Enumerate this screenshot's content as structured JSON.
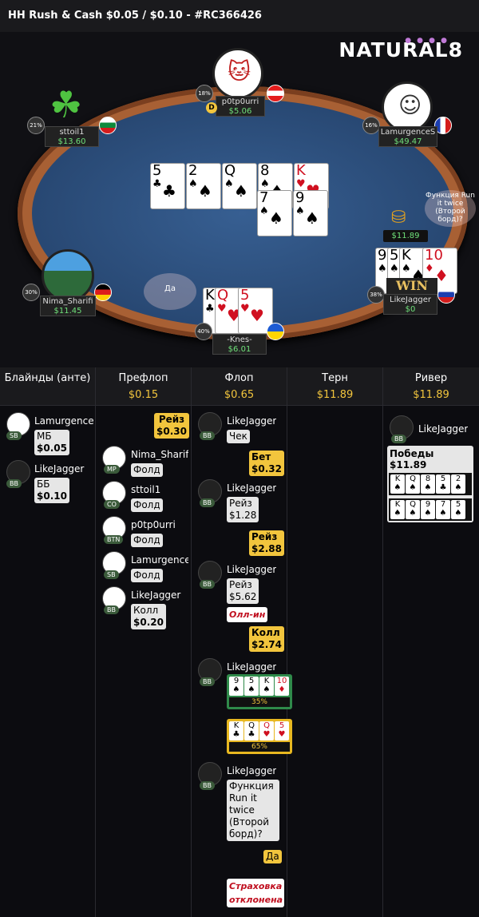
{
  "title": "HH Rush & Cash $0.05 / $0.10 - #RC366426",
  "brand": {
    "logo": "NATURAL8",
    "accent": "#f2c53d"
  },
  "board": {
    "row1": [
      {
        "r": "5",
        "s": "♣",
        "red": false
      },
      {
        "r": "2",
        "s": "♠",
        "red": false
      },
      {
        "r": "Q",
        "s": "♠",
        "red": false
      },
      {
        "r": "8",
        "s": "♠",
        "red": false
      },
      {
        "r": "K",
        "s": "♥",
        "red": true
      }
    ],
    "row2": [
      {
        "r": "7",
        "s": "♠",
        "red": false
      },
      {
        "r": "9",
        "s": "♠",
        "red": false
      }
    ]
  },
  "seats": {
    "top": {
      "name": "p0tp0urri",
      "amount": "$5.06",
      "pct": "18%",
      "dealer": "D"
    },
    "left": {
      "name": "sttoil1",
      "amount": "$13.60",
      "pct": "21%"
    },
    "right": {
      "name": "LamurgenceS",
      "amount": "$49.47",
      "pct": "16%"
    },
    "left_bottom": {
      "name": "Nima_Sharifi",
      "amount": "$11.45",
      "pct": "30%"
    },
    "bottom": {
      "name": "-Knes-",
      "amount": "$6.01",
      "pct": "40%",
      "cards": [
        {
          "r": "K",
          "s": "♣",
          "red": false
        },
        {
          "r": "Q",
          "s": "♥",
          "red": true
        },
        {
          "r": "5",
          "s": "♥",
          "red": true
        }
      ]
    },
    "right_bottom": {
      "name": "LikeJagger",
      "amount": "$0",
      "pct": "38%",
      "win": "WIN",
      "cards": [
        {
          "r": "9",
          "s": "♠",
          "red": false
        },
        {
          "r": "5",
          "s": "♠",
          "red": false
        },
        {
          "r": "K",
          "s": "♠",
          "red": false
        },
        {
          "r": "10",
          "s": "♦",
          "red": true
        }
      ]
    }
  },
  "pot_amount": "$11.89",
  "bubble_yes": "Да",
  "bubble_rit": "Функция Run it twice (Второй борд)?",
  "columns": [
    {
      "title": "Блайнды (анте)",
      "amount": ""
    },
    {
      "title": "Префлоп",
      "amount": "$0.15"
    },
    {
      "title": "Флоп",
      "amount": "$0.65"
    },
    {
      "title": "Терн",
      "amount": "$11.89"
    },
    {
      "title": "Ривер",
      "amount": "$11.89"
    }
  ],
  "blinds": [
    {
      "name": "Lamurgence",
      "pos": "SB",
      "action": "МБ",
      "amount": "$0.05"
    },
    {
      "name": "LikeJagger",
      "pos": "BB",
      "action": "ББ",
      "amount": "$0.10"
    }
  ],
  "preflop": {
    "raise": {
      "action": "Рейз",
      "amount": "$0.30"
    },
    "rows": [
      {
        "name": "Nima_Sharifi",
        "pos": "MP",
        "action": "Фолд"
      },
      {
        "name": "sttoil1",
        "pos": "CO",
        "action": "Фолд"
      },
      {
        "name": "p0tp0urri",
        "pos": "BTN",
        "action": "Фолд"
      },
      {
        "name": "Lamurgence",
        "pos": "SB",
        "action": "Фолд"
      },
      {
        "name": "LikeJagger",
        "pos": "BB",
        "action": "Колл",
        "amount": "$0.20"
      }
    ]
  },
  "flop": {
    "name": "LikeJagger",
    "pos": "BB",
    "check": "Чек",
    "bet": {
      "action": "Бет",
      "amount": "$0.32"
    },
    "raise1": {
      "action": "Рейз",
      "amount": "$1.28"
    },
    "raise2": {
      "action": "Рейз",
      "amount": "$2.88"
    },
    "raise3": {
      "action": "Рейз",
      "amount": "$5.62"
    },
    "allin": "Олл-ин",
    "call": {
      "action": "Колл",
      "amount": "$2.74"
    },
    "equity1": {
      "cards": [
        "9♠",
        "5♠",
        "K♠",
        "10♦"
      ],
      "pct": "35%"
    },
    "equity2": {
      "cards": [
        "K♣",
        "Q♣",
        "Q♥",
        "5♥"
      ],
      "pct": "65%"
    },
    "rit_question": "Функция Run it twice (Второй борд)?",
    "yes": "Да",
    "insurance": "Страховка отклонена"
  },
  "river": {
    "name": "LikeJagger",
    "pos": "BB",
    "wins": "Победы $11.89",
    "hand1": [
      "K♠",
      "Q♠",
      "8♠",
      "5♣",
      "2♠"
    ],
    "hand2": [
      "K♠",
      "Q♠",
      "9♠",
      "7♠",
      "5♠"
    ]
  }
}
